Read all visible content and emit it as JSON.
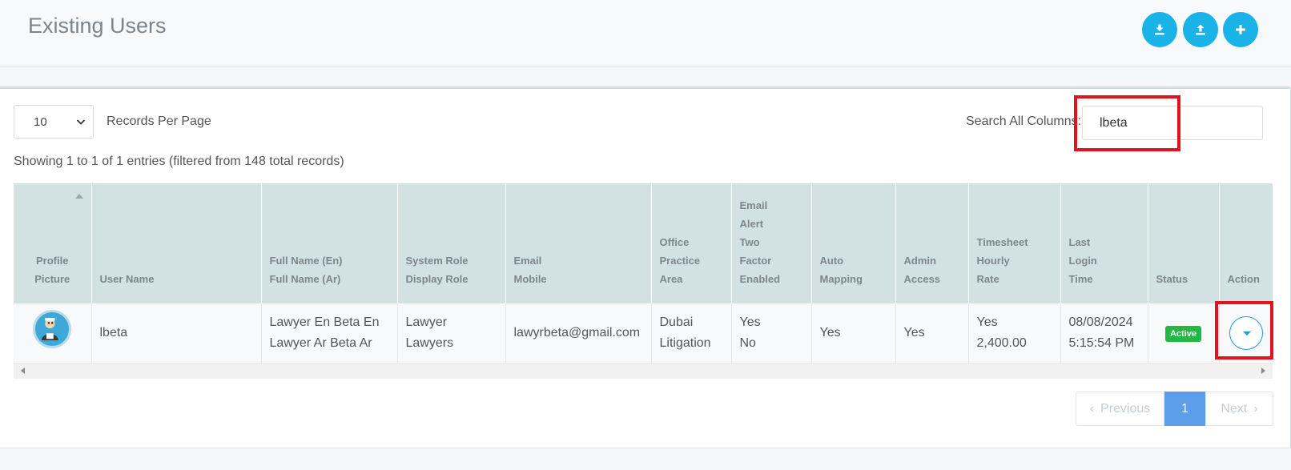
{
  "header": {
    "title": "Existing Users",
    "buttons": [
      {
        "name": "download-button",
        "icon": "download-icon"
      },
      {
        "name": "upload-button",
        "icon": "upload-icon"
      },
      {
        "name": "add-user-button",
        "icon": "plus-icon"
      }
    ],
    "accent_color": "#1ab3e8"
  },
  "controls": {
    "per_page_value": "10",
    "per_page_label": "Records Per Page",
    "search_label": "Search All Columns:",
    "search_value": "lbeta",
    "showing_text": "Showing 1 to 1 of 1 entries (filtered from 148 total records)"
  },
  "table": {
    "columns": [
      [
        "Profile",
        "Picture"
      ],
      [
        "User Name"
      ],
      [
        "Full Name (En)",
        "Full Name (Ar)"
      ],
      [
        "System Role",
        "Display Role"
      ],
      [
        "Email",
        "Mobile"
      ],
      [
        "Office",
        "Practice",
        "Area"
      ],
      [
        "Email",
        "Alert",
        "Two",
        "Factor",
        "Enabled"
      ],
      [
        "Auto",
        "Mapping"
      ],
      [
        "Admin",
        "Access"
      ],
      [
        "Timesheet",
        "Hourly",
        "Rate"
      ],
      [
        "Last",
        "Login",
        "Time"
      ],
      [
        "Status"
      ],
      [
        "Action"
      ]
    ],
    "rows": [
      {
        "avatar": "avatar-icon",
        "user_name": "lbeta",
        "full_name_en": "Lawyer En Beta En",
        "full_name_ar": "Lawyer Ar Beta Ar",
        "system_role": "Lawyer",
        "display_role": "Lawyers",
        "email": "lawyrbeta@gmail.com",
        "office": "Dubai",
        "practice_area": "Litigation",
        "email_alert": "Yes",
        "two_factor": "No",
        "auto_mapping": "Yes",
        "admin_access": "Yes",
        "timesheet": "Yes",
        "hourly_rate": "2,400.00",
        "last_login_date": "08/08/2024",
        "last_login_time": "5:15:54 PM",
        "status": "Active",
        "status_color": "#21b843"
      }
    ]
  },
  "pagination": {
    "previous": "Previous",
    "current": "1",
    "next": "Next",
    "active_color": "#5d9ee8"
  }
}
